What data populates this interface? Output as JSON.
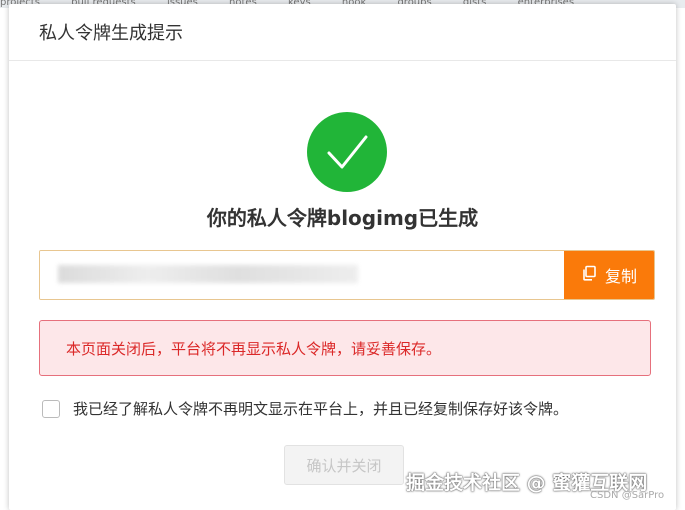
{
  "background_nav": [
    "projects",
    "pull requests",
    "issues",
    "notes",
    "keys",
    "hook",
    "groups",
    "gists",
    "enterprises"
  ],
  "dialog": {
    "title": "私人令牌生成提示",
    "success_title": "你的私人令牌blogimg已生成",
    "token_value": "",
    "copy_label": "复制",
    "warning": "本页面关闭后，平台将不再显示私人令牌，请妥善保存。",
    "confirm_text": "我已经了解私人令牌不再明文显示在平台上，并且已经复制保存好该令牌。",
    "confirm_button": "确认并关闭"
  },
  "watermark": "掘金技术社区 @ 蜜獾互联网",
  "credit": "CSDN @SarPro",
  "colors": {
    "success": "#21b538",
    "copy_button": "#fa7a0a",
    "warning_bg": "#fde7e9",
    "warning_text": "#db2828"
  },
  "icons": {
    "success": "checkmark-icon",
    "copy": "copy-icon"
  }
}
